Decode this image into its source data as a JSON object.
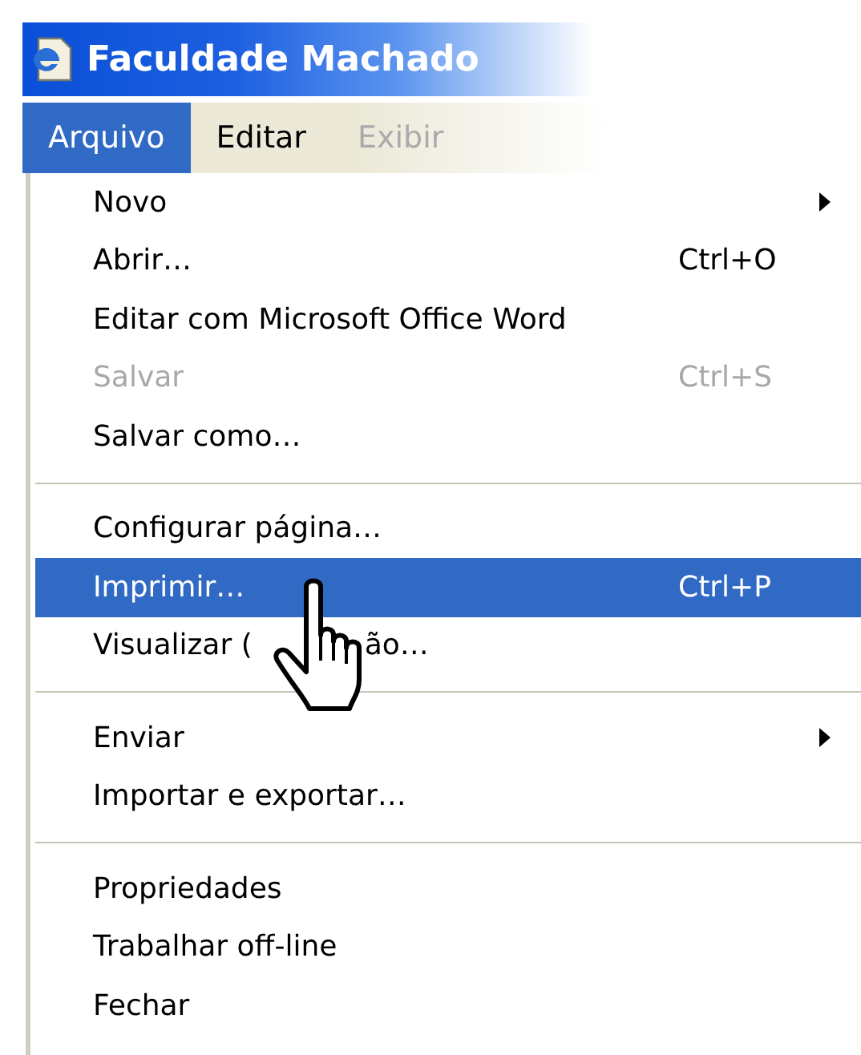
{
  "window": {
    "title": "Faculdade Machado"
  },
  "menubar": [
    {
      "label": "Arquivo",
      "selected": true,
      "faded": false
    },
    {
      "label": "Editar",
      "selected": false,
      "faded": false
    },
    {
      "label": "Exibir",
      "selected": false,
      "faded": true
    }
  ],
  "menu": [
    {
      "kind": "item",
      "label": "Novo",
      "submenu": true,
      "disabled": false,
      "selected": false
    },
    {
      "kind": "item",
      "label": "Abrir…",
      "shortcut": "Ctrl+O",
      "submenu": false,
      "disabled": false,
      "selected": false
    },
    {
      "kind": "item",
      "label": "Editar com Microsoft Office Word",
      "submenu": false,
      "disabled": false,
      "selected": false
    },
    {
      "kind": "item",
      "label": "Salvar",
      "shortcut": "Ctrl+S",
      "submenu": false,
      "disabled": true,
      "selected": false
    },
    {
      "kind": "item",
      "label": "Salvar como…",
      "submenu": false,
      "disabled": false,
      "selected": false
    },
    {
      "kind": "separator"
    },
    {
      "kind": "item",
      "label": "Configurar página…",
      "submenu": false,
      "disabled": false,
      "selected": false
    },
    {
      "kind": "item",
      "label": "Imprimir…",
      "shortcut": "Ctrl+P",
      "submenu": false,
      "disabled": false,
      "selected": true
    },
    {
      "kind": "item",
      "label": "Visualizar (",
      "label_tail": "ão…",
      "submenu": false,
      "disabled": false,
      "selected": false
    },
    {
      "kind": "separator"
    },
    {
      "kind": "item",
      "label": "Enviar",
      "submenu": true,
      "disabled": false,
      "selected": false
    },
    {
      "kind": "item",
      "label": "Importar e exportar…",
      "submenu": false,
      "disabled": false,
      "selected": false
    },
    {
      "kind": "separator"
    },
    {
      "kind": "item",
      "label": "Propriedades",
      "submenu": false,
      "disabled": false,
      "selected": false
    },
    {
      "kind": "item",
      "label": "Trabalhar off-line",
      "submenu": false,
      "disabled": false,
      "selected": false
    },
    {
      "kind": "item",
      "label": "Fechar",
      "submenu": false,
      "disabled": false,
      "selected": false
    }
  ]
}
